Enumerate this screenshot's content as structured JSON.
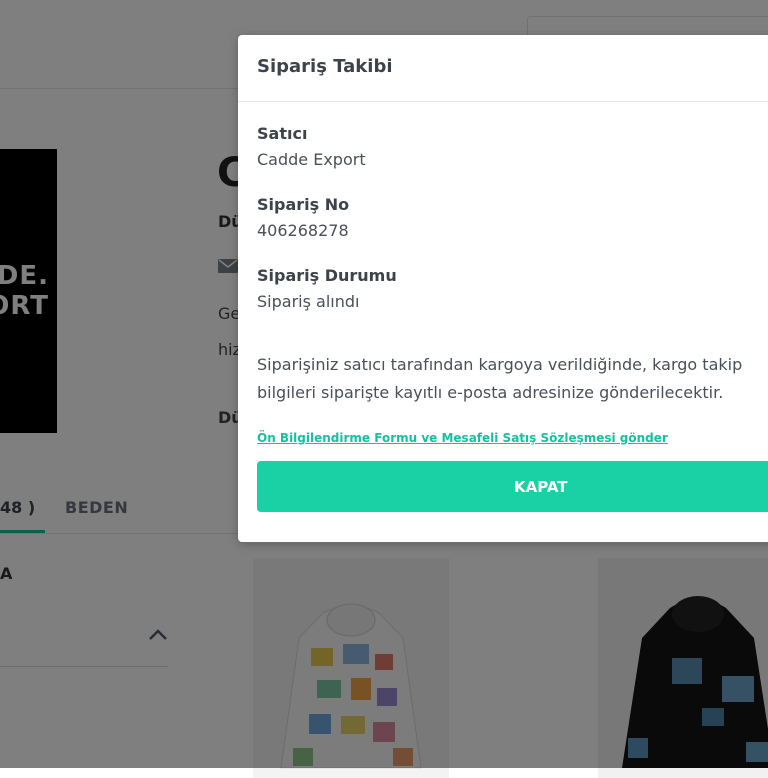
{
  "background": {
    "store_name_partial": "C",
    "store_subtitle_partial": "Dü",
    "description_line1_partial": "Ge",
    "description_line2_partial": "hiz",
    "description_line3_partial": "Dü",
    "logo_line1": "DE.",
    "logo_line2": "ORT",
    "tabs": {
      "size_count_partial": "48 )",
      "beden": "BEDEN"
    },
    "filter_label_partial": "A"
  },
  "modal": {
    "title": "Sipariş Takibi",
    "seller_label": "Satıcı",
    "seller_value": "Cadde Export",
    "order_no_label": "Sipariş No",
    "order_no_value": "406268278",
    "status_label": "Sipariş Durumu",
    "status_value": "Sipariş alındı",
    "info_text": "Siparişiniz satıcı tarafından kargoya verildiğinde, kargo takip bilgileri siparişte kayıtlı e-posta adresinize gönderilecektir.",
    "agreement_link": "Ön Bilgilendirme Formu ve Mesafeli Satış Sözleşmesi gönder",
    "close_button": "KAPAT"
  },
  "colors": {
    "accent": "#1ad1a5",
    "link": "#17c0a3",
    "overlay": "rgba(0,0,0,0.5)"
  }
}
